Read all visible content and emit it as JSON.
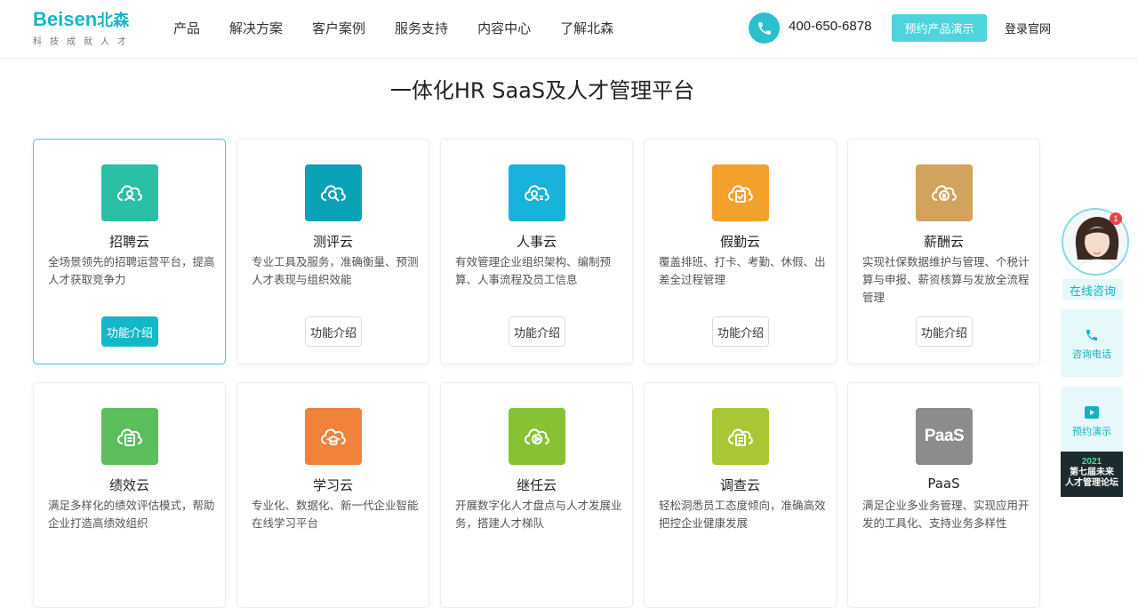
{
  "header": {
    "logo_text": "Beisen",
    "logo_cn": "北森",
    "logo_slogan": "科技成就人才",
    "nav": [
      "产品",
      "解决方案",
      "客户案例",
      "服务支持",
      "内容中心",
      "了解北森"
    ],
    "phone": "400-650-6878",
    "demo_label": "预约产品演示",
    "login_label": "登录官网"
  },
  "main": {
    "title": "一体化HR SaaS及人才管理平台",
    "cards": [
      {
        "name": "招聘云",
        "desc": "全场景领先的招聘运营平台，提高人才获取竞争力",
        "button": "功能介绍",
        "color": "#2bbfa5",
        "icon": "cloud-user-icon",
        "active": true
      },
      {
        "name": "测评云",
        "desc": "专业工具及服务，准确衡量、预测人才表现与组织效能",
        "button": "功能介绍",
        "color": "#0aa2b6",
        "icon": "cloud-search-icon",
        "active": false
      },
      {
        "name": "人事云",
        "desc": "有效管理企业组织架构、编制预算、人事流程及员工信息",
        "button": "功能介绍",
        "color": "#18b2dc",
        "icon": "cloud-people-icon",
        "active": false
      },
      {
        "name": "假勤云",
        "desc": "覆盖排班、打卡、考勤、休假、出差全过程管理",
        "button": "功能介绍",
        "color": "#f3a12d",
        "icon": "cloud-check-icon",
        "active": false
      },
      {
        "name": "薪酬云",
        "desc": "实现社保数据维护与管理、个税计算与申报、薪资核算与发放全流程管理",
        "button": "功能介绍",
        "color": "#d1a35c",
        "icon": "cloud-yen-icon",
        "active": false
      },
      {
        "name": "绩效云",
        "desc": "满足多样化的绩效评估模式，帮助企业打造高绩效组织",
        "color": "#5cbd5c",
        "icon": "cloud-doc-icon"
      },
      {
        "name": "学习云",
        "desc": "专业化、数据化、新一代企业智能在线学习平台",
        "color": "#f0823a",
        "icon": "cloud-graduation-icon"
      },
      {
        "name": "继任云",
        "desc": "开展数字化人才盘点与人才发展业务，搭建人才梯队",
        "color": "#86c234",
        "icon": "cloud-play-icon"
      },
      {
        "name": "调查云",
        "desc": "轻松洞悉员工态度倾向，准确高效把控企业健康发展",
        "color": "#a9c734",
        "icon": "cloud-survey-icon"
      },
      {
        "name": "PaaS",
        "desc": "满足企业多业务管理、实现应用开发的工具化、支持业务多样性",
        "color": "#8c8c8c",
        "icon": "paas-logo-icon",
        "logo_text": "PaaS"
      }
    ]
  },
  "side": {
    "badge": "1",
    "consult_label": "在线咨询",
    "phone_label": "咨询电话",
    "demo_label": "预约演示",
    "forum_year": "2021",
    "forum_line1": "第七届未来",
    "forum_line2": "人才管理论坛"
  }
}
